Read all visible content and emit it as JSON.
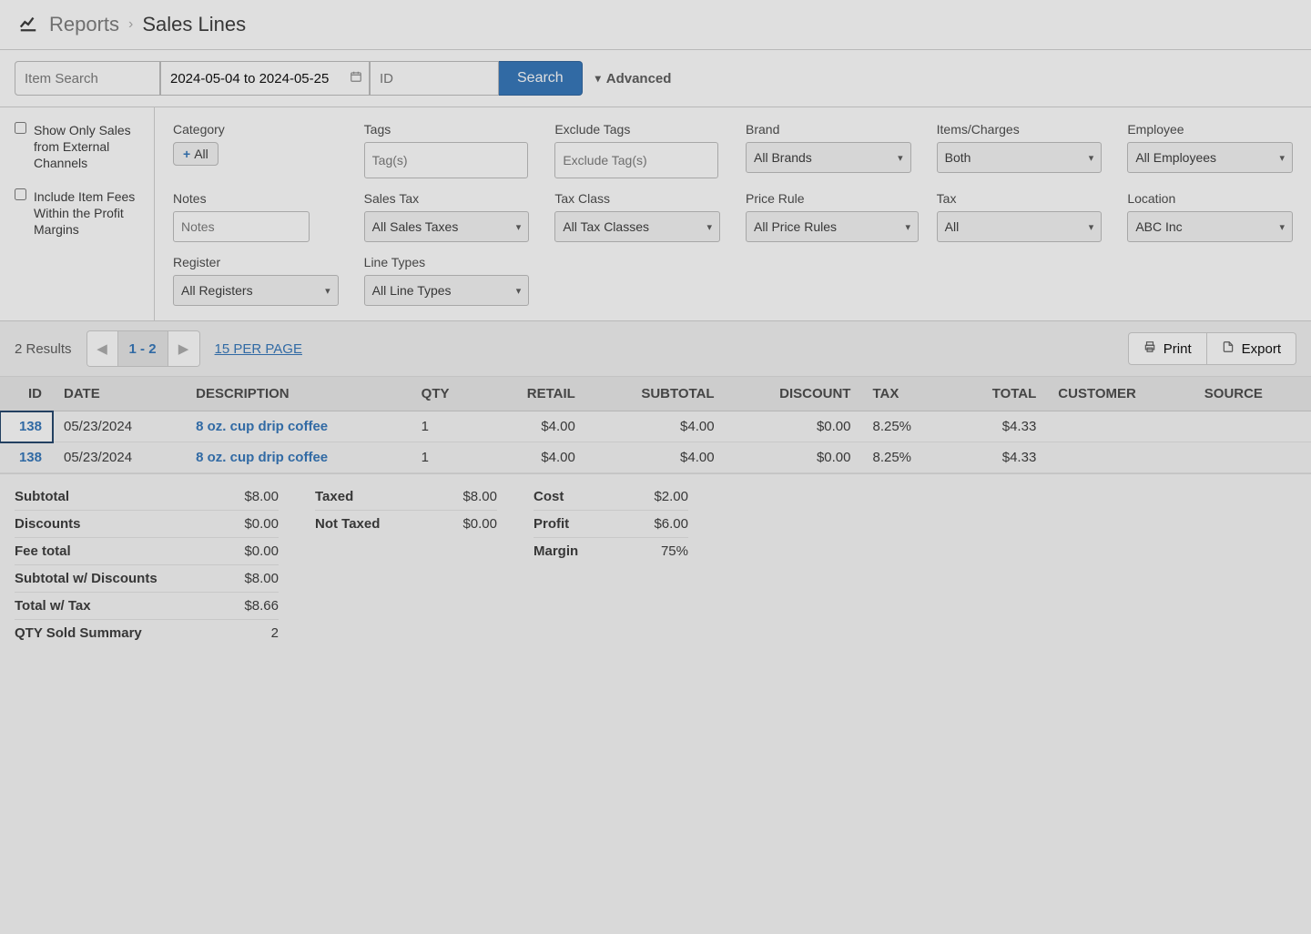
{
  "breadcrumb": {
    "root": "Reports",
    "current": "Sales Lines"
  },
  "search": {
    "item_placeholder": "Item Search",
    "date_value": "2024-05-04 to 2024-05-25",
    "id_placeholder": "ID",
    "search_btn": "Search",
    "advanced_label": "Advanced"
  },
  "adv_left": {
    "opt_external": "Show Only Sales from External Channels",
    "opt_fees": "Include Item Fees Within the Profit Margins"
  },
  "filters": {
    "category": {
      "label": "Category",
      "btn": "All"
    },
    "tags": {
      "label": "Tags",
      "placeholder": "Tag(s)"
    },
    "exclude_tags": {
      "label": "Exclude Tags",
      "placeholder": "Exclude Tag(s)"
    },
    "brand": {
      "label": "Brand",
      "value": "All Brands"
    },
    "items_charges": {
      "label": "Items/Charges",
      "value": "Both"
    },
    "employee": {
      "label": "Employee",
      "value": "All Employees"
    },
    "notes": {
      "label": "Notes",
      "placeholder": "Notes"
    },
    "sales_tax": {
      "label": "Sales Tax",
      "value": "All Sales Taxes"
    },
    "tax_class": {
      "label": "Tax Class",
      "value": "All Tax Classes"
    },
    "price_rule": {
      "label": "Price Rule",
      "value": "All Price Rules"
    },
    "tax": {
      "label": "Tax",
      "value": "All"
    },
    "location": {
      "label": "Location",
      "value": "ABC Inc"
    },
    "register": {
      "label": "Register",
      "value": "All Registers"
    },
    "line_types": {
      "label": "Line Types",
      "value": "All Line Types"
    }
  },
  "results_bar": {
    "count": "2 Results",
    "page_range": "1 - 2",
    "per_page": "15 PER PAGE",
    "print": "Print",
    "export": "Export"
  },
  "table": {
    "headers": {
      "id": "ID",
      "date": "DATE",
      "description": "DESCRIPTION",
      "qty": "QTY",
      "retail": "RETAIL",
      "subtotal": "SUBTOTAL",
      "discount": "DISCOUNT",
      "tax": "TAX",
      "total": "TOTAL",
      "customer": "CUSTOMER",
      "source": "SOURCE"
    },
    "rows": [
      {
        "id": "138",
        "date": "05/23/2024",
        "description": "8 oz. cup drip coffee",
        "qty": "1",
        "retail": "$4.00",
        "subtotal": "$4.00",
        "discount": "$0.00",
        "tax": "8.25%",
        "total": "$4.33",
        "customer": "",
        "source": ""
      },
      {
        "id": "138",
        "date": "05/23/2024",
        "description": "8 oz. cup drip coffee",
        "qty": "1",
        "retail": "$4.00",
        "subtotal": "$4.00",
        "discount": "$0.00",
        "tax": "8.25%",
        "total": "$4.33",
        "customer": "",
        "source": ""
      }
    ]
  },
  "summary": {
    "col1": [
      {
        "label": "Subtotal",
        "value": "$8.00"
      },
      {
        "label": "Discounts",
        "value": "$0.00"
      },
      {
        "label": "Fee total",
        "value": "$0.00"
      },
      {
        "label": "Subtotal w/ Discounts",
        "value": "$8.00"
      },
      {
        "label": "Total w/ Tax",
        "value": "$8.66"
      },
      {
        "label": "QTY Sold Summary",
        "value": "2"
      }
    ],
    "col2": [
      {
        "label": "Taxed",
        "value": "$8.00"
      },
      {
        "label": "Not Taxed",
        "value": "$0.00"
      }
    ],
    "col3": [
      {
        "label": "Cost",
        "value": "$2.00"
      },
      {
        "label": "Profit",
        "value": "$6.00"
      },
      {
        "label": "Margin",
        "value": "75%"
      }
    ]
  }
}
